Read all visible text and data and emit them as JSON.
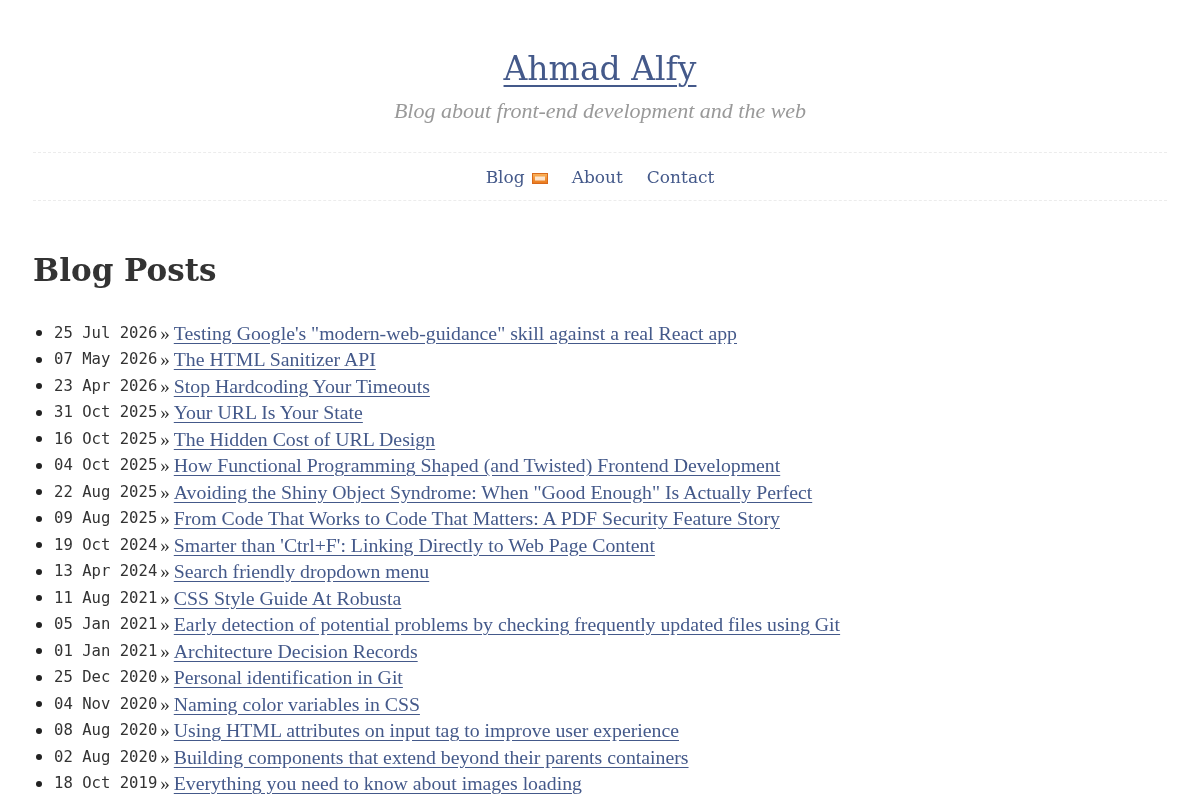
{
  "site": {
    "title": "Ahmad Alfy",
    "tagline": "Blog about front-end development and the web"
  },
  "nav": [
    {
      "label": "Blog",
      "rss": true
    },
    {
      "label": "About",
      "rss": false
    },
    {
      "label": "Contact",
      "rss": false
    }
  ],
  "heading": "Blog Posts",
  "posts": [
    {
      "date": "25 Jul 2026",
      "separator": "»",
      "title": "Testing Google's \"modern-web-guidance\" skill against a real React app"
    },
    {
      "date": "07 May 2026",
      "separator": "»",
      "title": "The HTML Sanitizer API"
    },
    {
      "date": "23 Apr 2026",
      "separator": "»",
      "title": "Stop Hardcoding Your Timeouts"
    },
    {
      "date": "31 Oct 2025",
      "separator": "»",
      "title": "Your URL Is Your State"
    },
    {
      "date": "16 Oct 2025",
      "separator": "»",
      "title": "The Hidden Cost of URL Design"
    },
    {
      "date": "04 Oct 2025",
      "separator": "»",
      "title": "How Functional Programming Shaped (and Twisted) Frontend Development"
    },
    {
      "date": "22 Aug 2025",
      "separator": "»",
      "title": "Avoiding the Shiny Object Syndrome: When \"Good Enough\" Is Actually Perfect"
    },
    {
      "date": "09 Aug 2025",
      "separator": "»",
      "title": "From Code That Works to Code That Matters: A PDF Security Feature Story"
    },
    {
      "date": "19 Oct 2024",
      "separator": "»",
      "title": "Smarter than 'Ctrl+F': Linking Directly to Web Page Content"
    },
    {
      "date": "13 Apr 2024",
      "separator": "»",
      "title": "Search friendly dropdown menu"
    },
    {
      "date": "11 Aug 2021",
      "separator": "»",
      "title": "CSS Style Guide At Robusta"
    },
    {
      "date": "05 Jan 2021",
      "separator": "»",
      "title": "Early detection of potential problems by checking frequently updated files using Git"
    },
    {
      "date": "01 Jan 2021",
      "separator": "»",
      "title": "Architecture Decision Records"
    },
    {
      "date": "25 Dec 2020",
      "separator": "»",
      "title": "Personal identification in Git"
    },
    {
      "date": "04 Nov 2020",
      "separator": "»",
      "title": "Naming color variables in CSS"
    },
    {
      "date": "08 Aug 2020",
      "separator": "»",
      "title": "Using HTML attributes on input tag to improve user experience"
    },
    {
      "date": "02 Aug 2020",
      "separator": "»",
      "title": "Building components that extend beyond their parents containers"
    },
    {
      "date": "18 Oct 2019",
      "separator": "»",
      "title": "Everything you need to know about images loading"
    }
  ]
}
